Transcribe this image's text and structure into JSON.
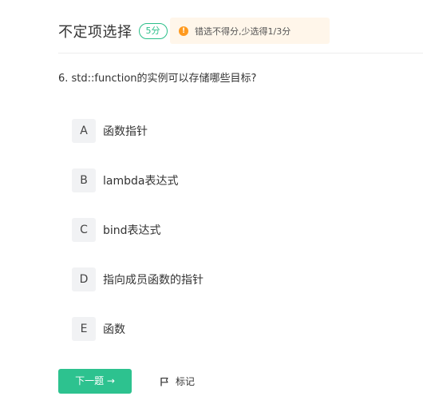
{
  "header": {
    "section_title": "不定项选择",
    "score_badge": "5分",
    "hint_icon": "warning-icon",
    "hint_icon_glyph": "!",
    "hint_text": "错选不得分,少选得1/3分"
  },
  "question": {
    "text": "6. std::function的实例可以存储哪些目标?"
  },
  "options": [
    {
      "letter": "A",
      "text": "函数指针"
    },
    {
      "letter": "B",
      "text": "lambda表达式"
    },
    {
      "letter": "C",
      "text": "bind表达式"
    },
    {
      "letter": "D",
      "text": "指向成员函数的指针"
    },
    {
      "letter": "E",
      "text": "函数"
    }
  ],
  "footer": {
    "next_label": "下一题 →",
    "mark_label": "标记",
    "mark_icon": "flag-icon"
  },
  "colors": {
    "accent": "#2dc28f",
    "hint_background": "#fff6ea",
    "hint_icon": "#ff9a1f"
  }
}
